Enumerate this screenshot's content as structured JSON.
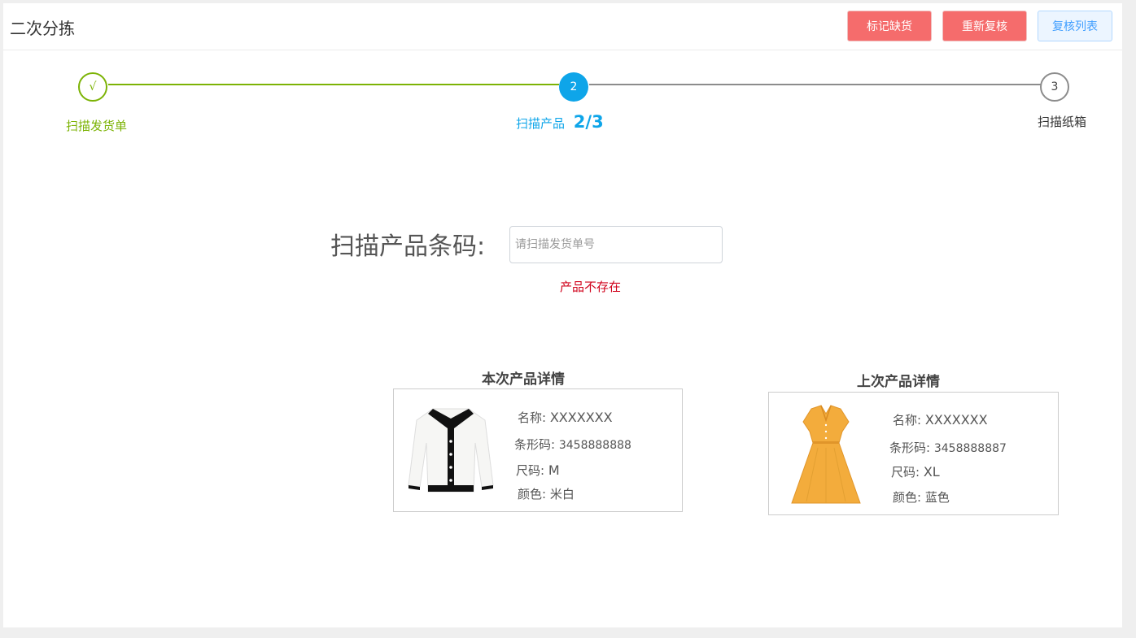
{
  "header": {
    "title": "二次分拣",
    "buttons": {
      "mark_out_of_stock": "标记缺货",
      "recheck": "重新复核",
      "recheck_list": "复核列表"
    }
  },
  "steps": [
    {
      "index": "√",
      "label": "扫描发货单",
      "status": "done"
    },
    {
      "index": "2",
      "label": "扫描产品",
      "progress": "2/3",
      "status": "active"
    },
    {
      "index": "3",
      "label": "扫描纸箱",
      "status": "pending"
    }
  ],
  "scan": {
    "label": "扫描产品条码:",
    "placeholder": "请扫描发货单号",
    "value": "",
    "error": "产品不存在"
  },
  "current_product": {
    "title": "本次产品详情",
    "name_label": "名称:",
    "name": "XXXXXXX",
    "barcode_label": "条形码:",
    "barcode": "3458888888",
    "size_label": "尺码:",
    "size": "M",
    "color_label": "颜色:",
    "color": "米白",
    "image": "cardigan-image"
  },
  "previous_product": {
    "title": "上次产品详情",
    "name_label": "名称:",
    "name": "XXXXXXX",
    "barcode_label": "条形码:",
    "barcode": "3458888887",
    "size_label": "尺码:",
    "size": "XL",
    "color_label": "颜色:",
    "color": "蓝色",
    "image": "dress-image"
  },
  "colors": {
    "done": "#7cb305",
    "active": "#0ea5e9",
    "pending": "#8c8c8c",
    "danger": "#f56c6c",
    "error": "#d0021b"
  }
}
